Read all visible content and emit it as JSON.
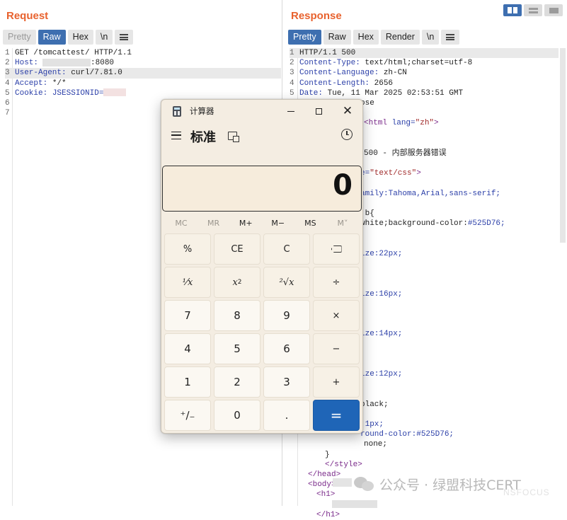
{
  "request": {
    "title": "Request",
    "tabs": [
      "Pretty",
      "Raw",
      "Hex",
      "\\n"
    ],
    "lines": [
      {
        "num": "1",
        "key": "GET /tomcattest/ HTTP/1.1",
        "val": ""
      },
      {
        "num": "2",
        "key": "Host:",
        "val": ":8080"
      },
      {
        "num": "3",
        "key": "User-Agent:",
        "val": " curl/7.81.0"
      },
      {
        "num": "4",
        "key": "Accept:",
        "val": " */*"
      },
      {
        "num": "5",
        "key": "Cookie:",
        "val": " JSESSIONID="
      },
      {
        "num": "6"
      },
      {
        "num": "7"
      }
    ]
  },
  "response": {
    "title": "Response",
    "tabs": [
      "Pretty",
      "Raw",
      "Hex",
      "Render",
      "\\n"
    ],
    "lines": [
      {
        "num": "1",
        "text": "HTTP/1.1 500"
      },
      {
        "num": "2",
        "key": "Content-Type:",
        "val": " text/html;charset=utf-8"
      },
      {
        "num": "3",
        "key": "Content-Language:",
        "val": " zh-CN"
      },
      {
        "num": "4",
        "key": "Content-Length:",
        "val": " 2656"
      },
      {
        "num": "5",
        "key": "Date:",
        "val": " Tue, 11 Mar 2025 02:53:51 GMT"
      }
    ],
    "partial": {
      "close": "ose",
      "html_tag": "<html",
      "lang_attr": " lang=",
      "lang_val": "\"zh\"",
      "tag_close": ">",
      "title_text": "500 - 内部服务器错误",
      "type_attr": "e=",
      "type_val": "\"text/css\"",
      "family": "amily:Tahoma,Arial,sans-serif;",
      "b": ",b{",
      "white": "white;background-color:",
      "white_hex": "#525D76;",
      "size22": "ize:22px;",
      "size16": "ize:16px;",
      "size14": "ize:14px;",
      "size12": "ize:12px;",
      "black": "black;",
      "onepx": ":1px;",
      "bg": "round-color:",
      "bg_hex": "#525D76;",
      "none": "none;",
      "brace": "}",
      "style_close": "</style>",
      "head_close": "</head>",
      "body_open": "<body>",
      "h1_open": "<h1>",
      "h1_close": "</h1>"
    }
  },
  "calculator": {
    "window_title": "计算器",
    "mode": "标准",
    "display_value": "0",
    "memory_buttons": [
      "MC",
      "MR",
      "M+",
      "M−",
      "MS",
      "M˅"
    ],
    "keys": [
      "%",
      "CE",
      "C",
      "backspace",
      "1/x",
      "x2",
      "sqrt",
      "÷",
      "7",
      "8",
      "9",
      "×",
      "4",
      "5",
      "6",
      "−",
      "1",
      "2",
      "3",
      "+",
      "+/−",
      "0",
      ".",
      "="
    ],
    "key_labels": {
      "percent": "%",
      "ce": "CE",
      "c": "C",
      "reciprocal": "¹⁄x",
      "square_base": "x",
      "square_sup": "2",
      "sqrt": "²√x",
      "divide": "÷",
      "k7": "7",
      "k8": "8",
      "k9": "9",
      "multiply": "×",
      "k4": "4",
      "k5": "5",
      "k6": "6",
      "minus": "−",
      "k1": "1",
      "k2": "2",
      "k3": "3",
      "plus": "+",
      "negate": "⁺∕₋",
      "k0": "0",
      "decimal": ".",
      "equals": "="
    },
    "accent_color": "#1f65b7"
  },
  "watermark": {
    "text": "公众号 · 绿盟科技CERT",
    "sub": "NSFOCUS"
  },
  "colors": {
    "pane_title": "#e8622e",
    "active_tab": "#3e6fb0"
  }
}
